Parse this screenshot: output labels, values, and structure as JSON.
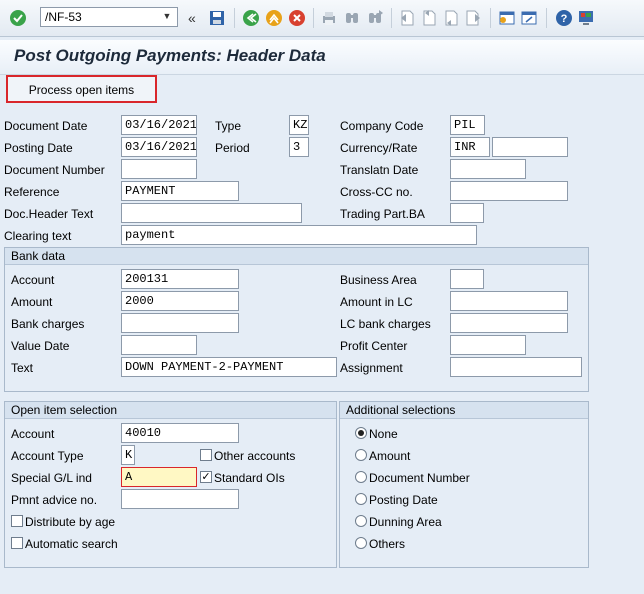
{
  "toolbar": {
    "command_value": "/NF-53",
    "icons": [
      "enter-icon",
      "save-icon",
      "back-icon",
      "exit-icon",
      "cancel-icon",
      "print-icon",
      "find-icon",
      "find-next-icon",
      "first-page-icon",
      "prev-page-icon",
      "next-page-icon",
      "last-page-icon",
      "create-session-icon",
      "shortcut-icon",
      "help-icon",
      "customize-layout-icon"
    ]
  },
  "page_title": "Post Outgoing Payments: Header Data",
  "process_button": "Process open items",
  "header": {
    "document_date": {
      "label": "Document Date",
      "value": "03/16/2021"
    },
    "type": {
      "label": "Type",
      "value": "KZ"
    },
    "company_code": {
      "label": "Company Code",
      "value": "PIL"
    },
    "posting_date": {
      "label": "Posting Date",
      "value": "03/16/2021"
    },
    "period": {
      "label": "Period",
      "value": "3"
    },
    "currency_rate": {
      "label": "Currency/Rate",
      "value": "INR",
      "rate": ""
    },
    "document_number": {
      "label": "Document Number",
      "value": ""
    },
    "translatn_date": {
      "label": "Translatn Date",
      "value": ""
    },
    "reference": {
      "label": "Reference",
      "value": "PAYMENT"
    },
    "cross_cc": {
      "label": "Cross-CC no.",
      "value": ""
    },
    "doc_header_text": {
      "label": "Doc.Header Text",
      "value": ""
    },
    "trading_part": {
      "label": "Trading Part.BA",
      "value": ""
    },
    "clearing_text": {
      "label": "Clearing text",
      "value": "payment"
    }
  },
  "bank_data": {
    "title": "Bank data",
    "account": {
      "label": "Account",
      "value": "200131"
    },
    "business_area": {
      "label": "Business Area",
      "value": ""
    },
    "amount": {
      "label": "Amount",
      "value": "2000"
    },
    "amount_lc": {
      "label": "Amount in LC",
      "value": ""
    },
    "bank_charges": {
      "label": "Bank charges",
      "value": ""
    },
    "lc_bank_charges": {
      "label": "LC bank charges",
      "value": ""
    },
    "value_date": {
      "label": "Value Date",
      "value": ""
    },
    "profit_center": {
      "label": "Profit Center",
      "value": ""
    },
    "text": {
      "label": "Text",
      "value": "DOWN PAYMENT-2-PAYMENT"
    },
    "assignment": {
      "label": "Assignment",
      "value": ""
    }
  },
  "open_item": {
    "title": "Open item selection",
    "account": {
      "label": "Account",
      "value": "40010"
    },
    "account_type": {
      "label": "Account Type",
      "value": "K"
    },
    "other_accounts": {
      "label": "Other accounts",
      "checked": false
    },
    "special_gl": {
      "label": "Special G/L ind",
      "value": "A"
    },
    "standard_ois": {
      "label": "Standard OIs",
      "checked": true
    },
    "pmnt_advice": {
      "label": "Pmnt advice no.",
      "value": ""
    },
    "distribute_by_age": {
      "label": "Distribute by age",
      "checked": false
    },
    "automatic_search": {
      "label": "Automatic search",
      "checked": false
    }
  },
  "additional": {
    "title": "Additional selections",
    "options": [
      "None",
      "Amount",
      "Document Number",
      "Posting Date",
      "Dunning Area",
      "Others"
    ],
    "selected": "None"
  }
}
